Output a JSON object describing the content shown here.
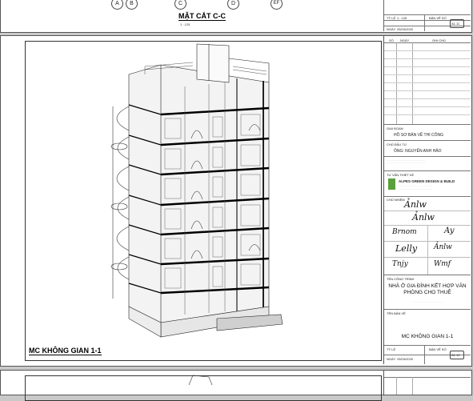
{
  "top_sheet": {
    "grid_bubbles": [
      "A",
      "B",
      "C",
      "D",
      "EF"
    ],
    "section_title": "MẶT CẮT C-C",
    "scale": "1 : 125",
    "title_block": {
      "scale_label": "TỶ LỆ",
      "scale_value": "1 : 125",
      "date_label": "NGÀY",
      "date_value": "25/03/2020",
      "sheet_label": "BẢN VẼ SỐ",
      "sheet_no": "A1.11"
    }
  },
  "main_sheet": {
    "view_title": "MC KHÔNG GIAN 1-1",
    "title_block": {
      "stage_label": "GIAI ĐOẠN",
      "stage_value": "HỒ SƠ BẢN VẼ THI CÔNG",
      "owner_label": "CHỦ ĐẦU TƯ",
      "owner_value": "ÔNG: NGUYỄN ANH HẢO",
      "designer_label": "TƯ VẤN THIẾT KẾ",
      "firm_name": "ALPES GREEN DESIGN & BUILD",
      "project_label": "TÊN CÔNG TRÌNH",
      "project_name": "NHÀ Ở GIA ĐÌNH KẾT HỢP VĂN PHÒNG CHO THUÊ",
      "drawing_label": "TÊN BẢN VẼ",
      "drawing_name": "MC KHÔNG GIAN 1-1",
      "scale_label": "TỶ LỆ",
      "date_label": "NGÀY",
      "date_value": "25/03/2020",
      "sheet_label": "BẢN VẼ SỐ",
      "sheet_no": "A1.12",
      "chief_label": "CHỦ NHIỆM",
      "chief_name": "KTS. LÊ QUANG LONG",
      "design_label": "THIẾT KẾ",
      "check_label": "KIỂM TRA",
      "header_no": "SỐ",
      "header_date": "NGÀY",
      "header_note": "GHI CHÚ"
    }
  }
}
